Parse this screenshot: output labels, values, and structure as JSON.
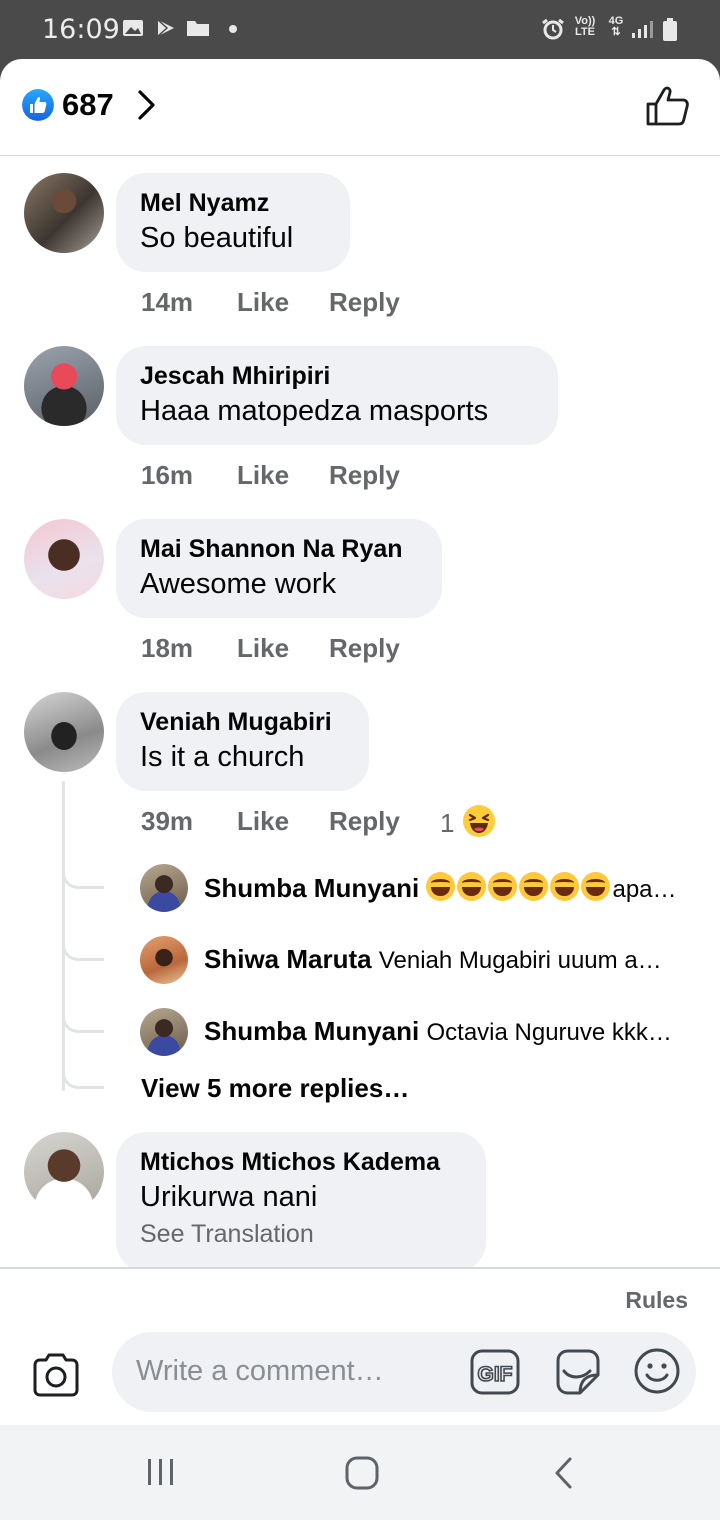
{
  "status_bar": {
    "time": "16:09",
    "signal_labels": [
      "Vo))",
      "LTE",
      "4G"
    ],
    "icons": [
      "image-icon",
      "play-store-icon",
      "folder-icon",
      "dot-icon",
      "alarm-icon",
      "signal-icon",
      "battery-icon"
    ]
  },
  "header": {
    "like_count": "687",
    "icons": [
      "like-badge-icon",
      "chevron-right-icon",
      "thumbs-up-outline-icon"
    ]
  },
  "comments": [
    {
      "name": "Mel Nyamz",
      "text": "So beautiful",
      "time": "14m",
      "like": "Like",
      "reply": "Reply"
    },
    {
      "name": "Jescah Mhiripiri",
      "text": "Haaa matopedza masports",
      "time": "16m",
      "like": "Like",
      "reply": "Reply"
    },
    {
      "name": "Mai Shannon Na Ryan",
      "text": "Awesome work",
      "time": "18m",
      "like": "Like",
      "reply": "Reply"
    },
    {
      "name": "Veniah Mugabiri",
      "text": "Is it a church",
      "time": "39m",
      "like": "Like",
      "reply": "Reply",
      "reaction_count": "1"
    },
    {
      "name": "Mtichos Mtichos Kadema",
      "text": "Urikurwa nani",
      "see_translation": "See Translation"
    }
  ],
  "replies": [
    {
      "name": "Shumba Munyani",
      "text": "apa…",
      "emoji_count": 6
    },
    {
      "name": "Shiwa Maruta",
      "text": "Veniah Mugabiri uuum a…"
    },
    {
      "name": "Shumba Munyani",
      "text": "Octavia Nguruve kkk…"
    }
  ],
  "view_more_replies": "View 5 more replies…",
  "footer": {
    "rules": "Rules",
    "composer_placeholder": "Write a comment…",
    "gif_label": "GIF",
    "icons": [
      "camera-icon",
      "gif-icon",
      "sticker-icon",
      "emoji-icon"
    ]
  },
  "nav_bar": {
    "icons": [
      "recent-apps-icon",
      "home-icon",
      "back-icon"
    ]
  },
  "colors": {
    "like_blue": "#1877f2",
    "bubble_bg": "#eff1f4",
    "secondary_text": "#65676b",
    "status_bar_bg": "#4a4a4a"
  }
}
